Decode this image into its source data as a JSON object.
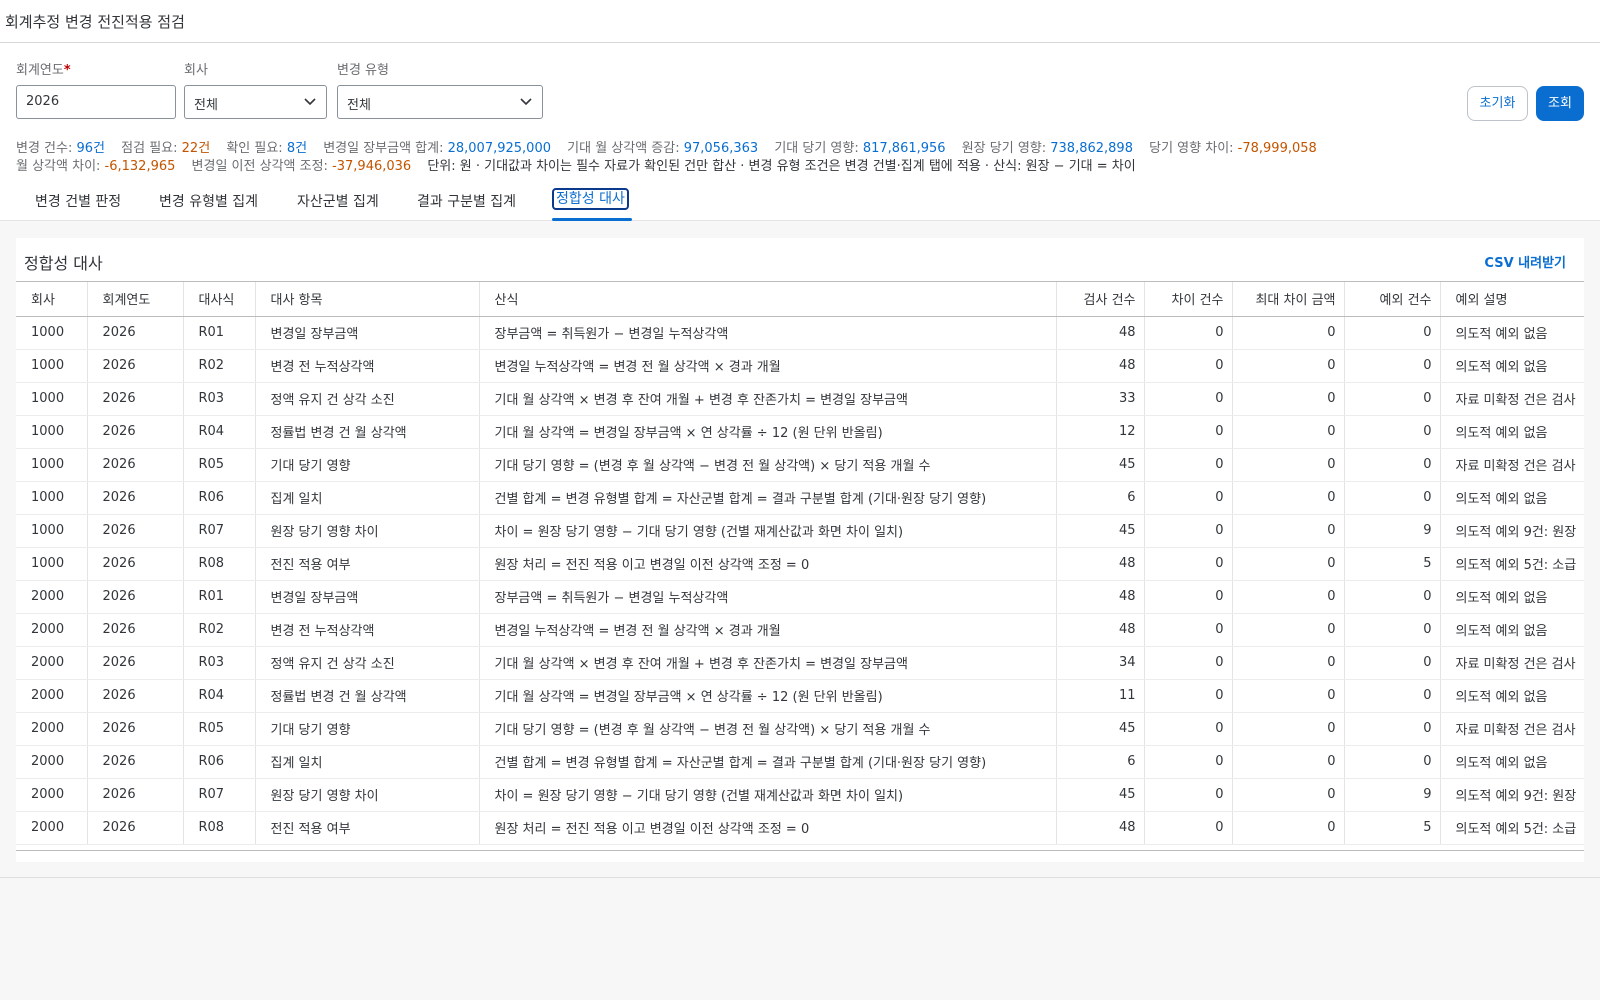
{
  "page": {
    "title": "회계추정 변경 전진적용 점검"
  },
  "filters": {
    "year": {
      "label": "회계연도",
      "required_mark": "*",
      "value": "2026"
    },
    "company": {
      "label": "회사",
      "value": "전체"
    },
    "change_type": {
      "label": "변경 유형",
      "value": "전체"
    }
  },
  "actions": {
    "reset": "초기화",
    "search": "조회"
  },
  "summary": [
    {
      "key": "변경 건수: ",
      "value": "96건",
      "color": "blue"
    },
    {
      "key": "점검 필요: ",
      "value": "22건",
      "color": "orange"
    },
    {
      "key": "확인 필요: ",
      "value": "8건",
      "color": "blue"
    },
    {
      "key": "변경일 장부금액 합계: ",
      "value": "28,007,925,000",
      "color": "blue"
    },
    {
      "key": "기대 월 상각액 증감: ",
      "value": "97,056,363",
      "color": "blue"
    },
    {
      "key": "기대 당기 영향: ",
      "value": "817,861,956",
      "color": "blue"
    },
    {
      "key": "원장 당기 영향: ",
      "value": "738,862,898",
      "color": "blue"
    },
    {
      "key": "당기 영향 차이: ",
      "value": "-78,999,058",
      "color": "orange"
    },
    {
      "key": "월 상각액 차이: ",
      "value": "-6,132,965",
      "color": "orange"
    },
    {
      "key": "변경일 이전 상각액 조정: ",
      "value": "-37,946,036",
      "color": "orange"
    }
  ],
  "summary_note": "단위: 원 · 기대값과 차이는 필수 자료가 확인된 건만 합산 · 변경 유형 조건은 변경 건별·집계 탭에 적용 · 산식: 원장 − 기대 = 차이",
  "tabs": [
    {
      "label": "변경 건별 판정"
    },
    {
      "label": "변경 유형별 집계"
    },
    {
      "label": "자산군별 집계"
    },
    {
      "label": "결과 구분별 집계"
    },
    {
      "label": "정합성 대사",
      "active": true
    }
  ],
  "panel": {
    "title": "정합성 대사",
    "csv_label": "CSV 내려받기"
  },
  "table": {
    "columns": [
      "회사",
      "회계연도",
      "대사식",
      "대사 항목",
      "산식",
      "검사 건수",
      "차이 건수",
      "최대 차이 금액",
      "예외 건수",
      "예외 설명"
    ],
    "rows": [
      [
        "1000",
        "2026",
        "R01",
        "변경일 장부금액",
        "장부금액 = 취득원가 − 변경일 누적상각액",
        "48",
        "0",
        "0",
        "0",
        "의도적 예외 없음"
      ],
      [
        "1000",
        "2026",
        "R02",
        "변경 전 누적상각액",
        "변경일 누적상각액 = 변경 전 월 상각액 × 경과 개월",
        "48",
        "0",
        "0",
        "0",
        "의도적 예외 없음"
      ],
      [
        "1000",
        "2026",
        "R03",
        "정액 유지 건 상각 소진",
        "기대 월 상각액 × 변경 후 잔여 개월 + 변경 후 잔존가치 = 변경일 장부금액",
        "33",
        "0",
        "0",
        "0",
        "자료 미확정 건은 검사"
      ],
      [
        "1000",
        "2026",
        "R04",
        "정률법 변경 건 월 상각액",
        "기대 월 상각액 = 변경일 장부금액 × 연 상각률 ÷ 12 (원 단위 반올림)",
        "12",
        "0",
        "0",
        "0",
        "의도적 예외 없음"
      ],
      [
        "1000",
        "2026",
        "R05",
        "기대 당기 영향",
        "기대 당기 영향 = (변경 후 월 상각액 − 변경 전 월 상각액) × 당기 적용 개월 수",
        "45",
        "0",
        "0",
        "0",
        "자료 미확정 건은 검사"
      ],
      [
        "1000",
        "2026",
        "R06",
        "집계 일치",
        "건별 합계 = 변경 유형별 합계 = 자산군별 합계 = 결과 구분별 합계 (기대·원장 당기 영향)",
        "6",
        "0",
        "0",
        "0",
        "의도적 예외 없음"
      ],
      [
        "1000",
        "2026",
        "R07",
        "원장 당기 영향 차이",
        "차이 = 원장 당기 영향 − 기대 당기 영향 (건별 재계산값과 화면 차이 일치)",
        "45",
        "0",
        "0",
        "9",
        "의도적 예외 9건: 원장"
      ],
      [
        "1000",
        "2026",
        "R08",
        "전진 적용 여부",
        "원장 처리 = 전진 적용 이고 변경일 이전 상각액 조정 = 0",
        "48",
        "0",
        "0",
        "5",
        "의도적 예외 5건: 소급"
      ],
      [
        "2000",
        "2026",
        "R01",
        "변경일 장부금액",
        "장부금액 = 취득원가 − 변경일 누적상각액",
        "48",
        "0",
        "0",
        "0",
        "의도적 예외 없음"
      ],
      [
        "2000",
        "2026",
        "R02",
        "변경 전 누적상각액",
        "변경일 누적상각액 = 변경 전 월 상각액 × 경과 개월",
        "48",
        "0",
        "0",
        "0",
        "의도적 예외 없음"
      ],
      [
        "2000",
        "2026",
        "R03",
        "정액 유지 건 상각 소진",
        "기대 월 상각액 × 변경 후 잔여 개월 + 변경 후 잔존가치 = 변경일 장부금액",
        "34",
        "0",
        "0",
        "0",
        "자료 미확정 건은 검사"
      ],
      [
        "2000",
        "2026",
        "R04",
        "정률법 변경 건 월 상각액",
        "기대 월 상각액 = 변경일 장부금액 × 연 상각률 ÷ 12 (원 단위 반올림)",
        "11",
        "0",
        "0",
        "0",
        "의도적 예외 없음"
      ],
      [
        "2000",
        "2026",
        "R05",
        "기대 당기 영향",
        "기대 당기 영향 = (변경 후 월 상각액 − 변경 전 월 상각액) × 당기 적용 개월 수",
        "45",
        "0",
        "0",
        "0",
        "자료 미확정 건은 검사"
      ],
      [
        "2000",
        "2026",
        "R06",
        "집계 일치",
        "건별 합계 = 변경 유형별 합계 = 자산군별 합계 = 결과 구분별 합계 (기대·원장 당기 영향)",
        "6",
        "0",
        "0",
        "0",
        "의도적 예외 없음"
      ],
      [
        "2000",
        "2026",
        "R07",
        "원장 당기 영향 차이",
        "차이 = 원장 당기 영향 − 기대 당기 영향 (건별 재계산값과 화면 차이 일치)",
        "45",
        "0",
        "0",
        "9",
        "의도적 예외 9건: 원장"
      ],
      [
        "2000",
        "2026",
        "R08",
        "전진 적용 여부",
        "원장 처리 = 전진 적용 이고 변경일 이전 상각액 조정 = 0",
        "48",
        "0",
        "0",
        "5",
        "의도적 예외 5건: 소급"
      ]
    ]
  },
  "colors": {
    "accent": "#0a6ed1",
    "warning": "#c35500",
    "required": "#bb0000"
  }
}
